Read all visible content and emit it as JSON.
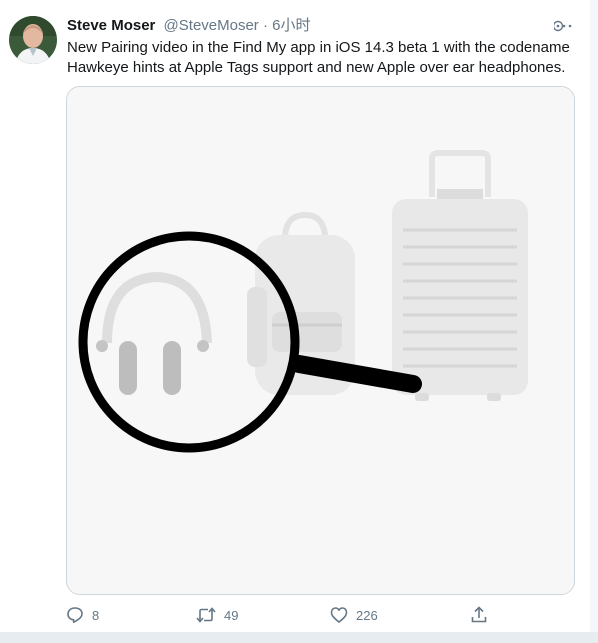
{
  "tweet": {
    "author": {
      "display_name": "Steve Moser",
      "handle": "@SteveMoser",
      "separator": "·",
      "time": "6小时"
    },
    "text": "New Pairing video in the Find My app in iOS 14.3 beta 1 with the codename Hawkeye hints at Apple Tags support and new Apple over ear headphones.",
    "media": {
      "icons": [
        "headphones-icon",
        "backpack-icon",
        "suitcase-icon",
        "magnifying-glass-icon"
      ]
    },
    "actions": {
      "reply": {
        "icon": "reply-icon",
        "count": "8"
      },
      "retweet": {
        "icon": "retweet-icon",
        "count": "49"
      },
      "like": {
        "icon": "heart-icon",
        "count": "226"
      },
      "share": {
        "icon": "share-icon"
      }
    },
    "more_icon": "more-icon"
  },
  "colors": {
    "text_primary": "#14171a",
    "text_secondary": "#657786",
    "border": "#ccd6dd"
  }
}
